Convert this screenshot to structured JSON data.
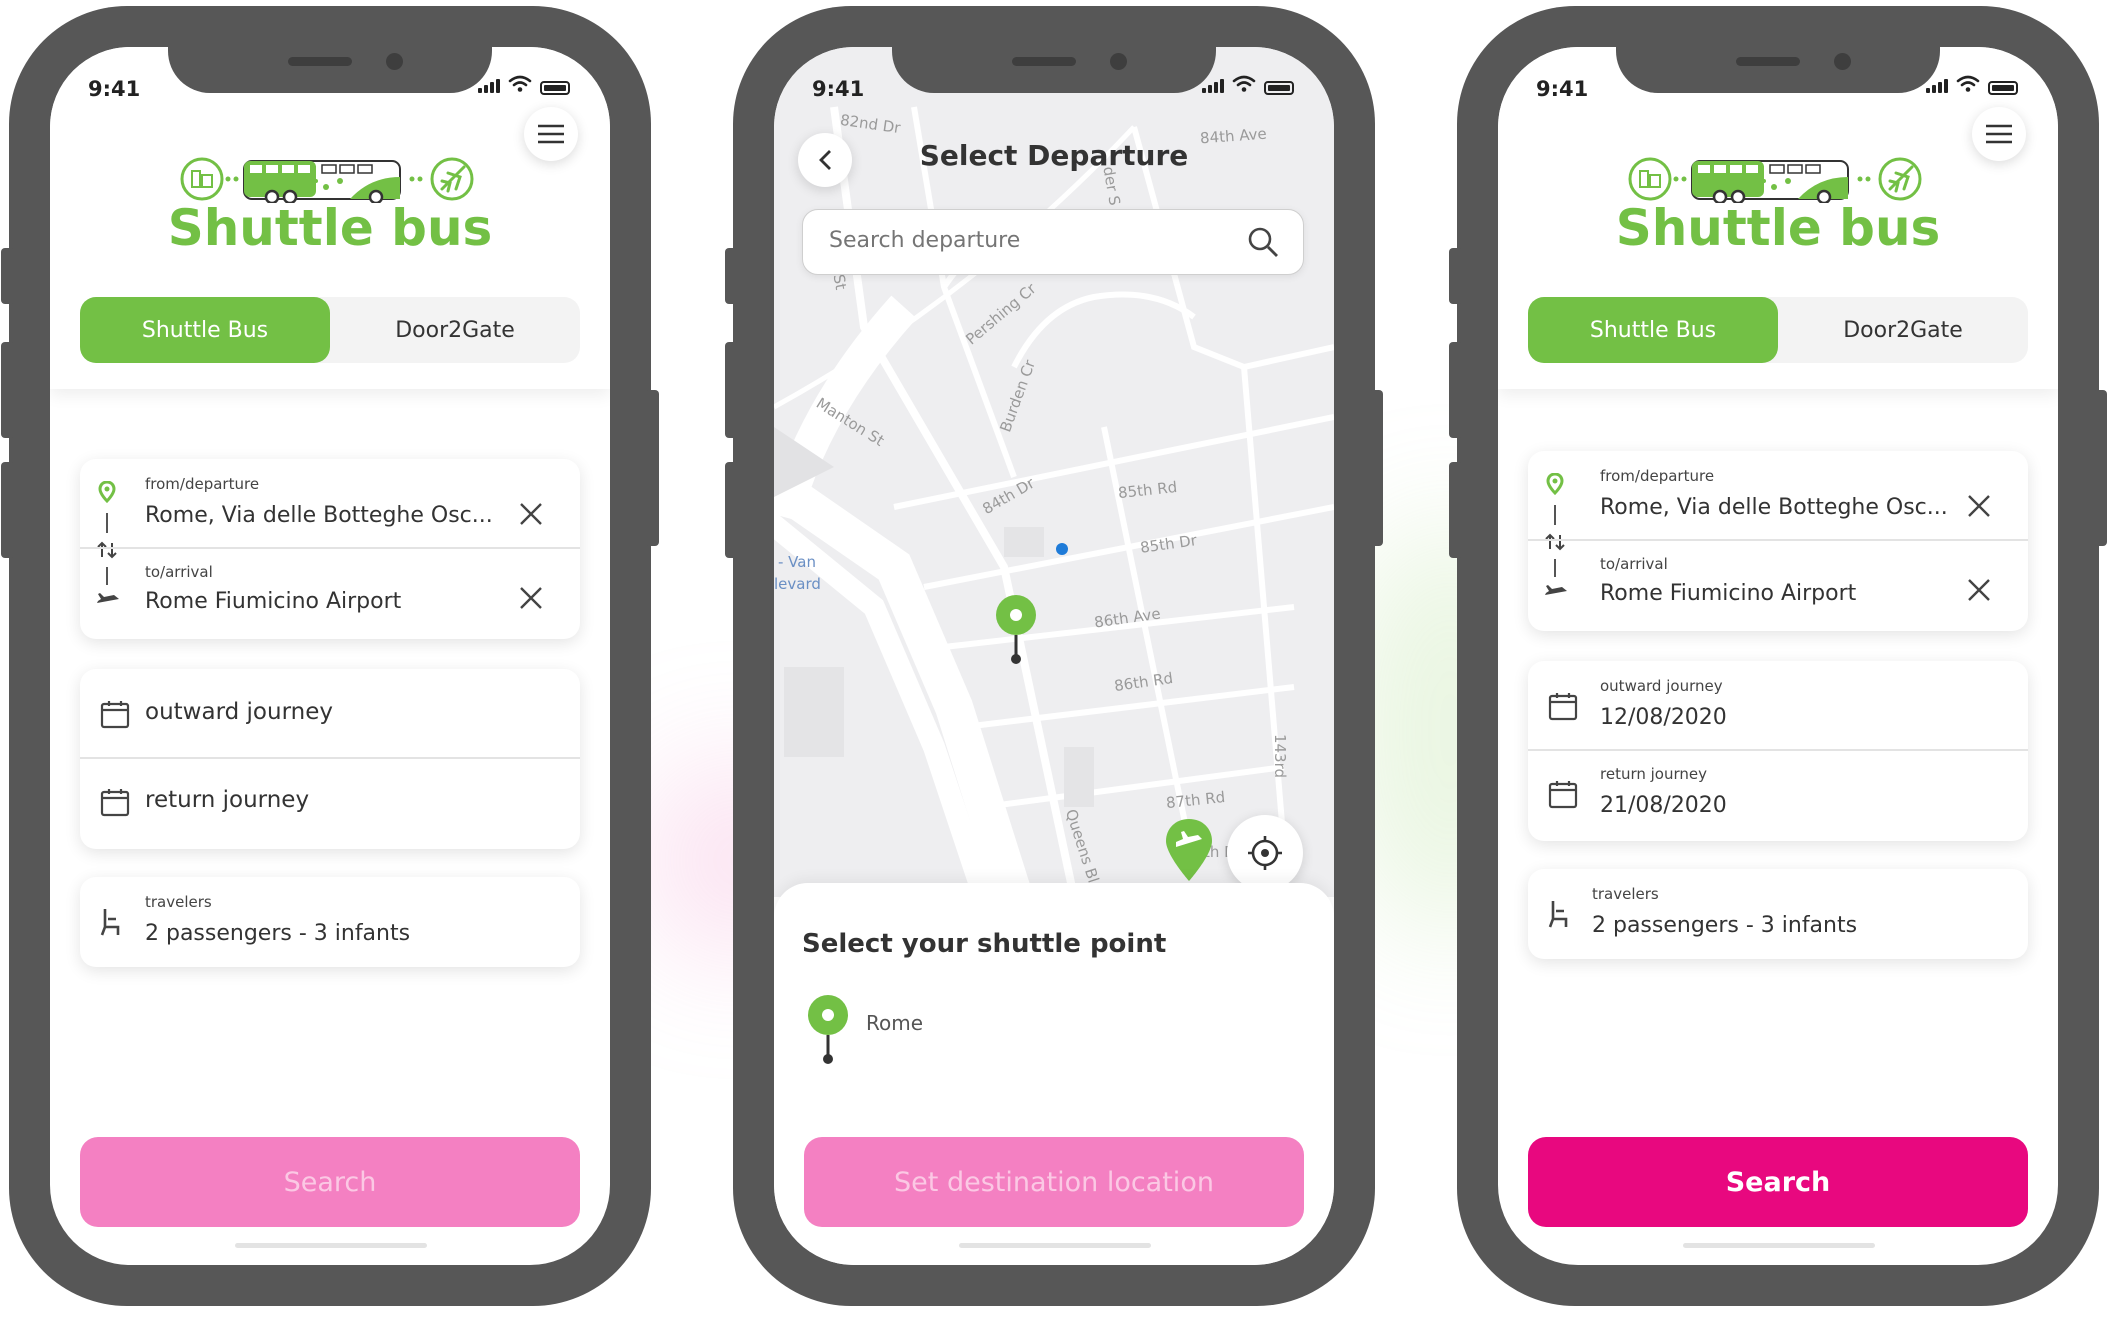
{
  "status_time": "9:41",
  "brand_title": "Shuttle bus",
  "colors": {
    "green": "#73c045",
    "pink_disabled": "#f480c2",
    "pink_active": "#e8087f",
    "frame": "#575757"
  },
  "screen1": {
    "tabs": [
      {
        "label": "Shuttle Bus",
        "active": true
      },
      {
        "label": "Door2Gate",
        "active": false
      }
    ],
    "from_label": "from/departure",
    "from_value": "Rome, Via delle Botteghe Osc...",
    "to_label": "to/arrival",
    "to_value": "Rome Fiumicino Airport",
    "outward_placeholder": "outward journey",
    "return_placeholder": "return journey",
    "travelers_label": "travelers",
    "travelers_value": "2 passengers - 3 infants",
    "search_label": "Search",
    "search_enabled": false
  },
  "screen2": {
    "title": "Select Departure",
    "search_placeholder": "Search departure",
    "map_labels": [
      "82nd Dr",
      "84th Ave",
      "Pershing Cr",
      "Burden Cr",
      "Manton St",
      "84th Dr",
      "85th Rd",
      "85th Dr",
      "86th Ave",
      "86th Rd",
      "87th Rd",
      "Queens Bl",
      "143rd",
      "- Van",
      "levard",
      "th Dr",
      "der S",
      "St"
    ],
    "sheet_title": "Select your shuttle point",
    "point_label": "Rome",
    "action_label": "Set destination location",
    "action_enabled": false
  },
  "screen3": {
    "tabs": [
      {
        "label": "Shuttle Bus",
        "active": true
      },
      {
        "label": "Door2Gate",
        "active": false
      }
    ],
    "from_label": "from/departure",
    "from_value": "Rome, Via delle Botteghe Osc...",
    "to_label": "to/arrival",
    "to_value": "Rome Fiumicino Airport",
    "outward_label": "outward journey",
    "outward_value": "12/08/2020",
    "return_label": "return journey",
    "return_value": "21/08/2020",
    "travelers_label": "travelers",
    "travelers_value": "2 passengers - 3 infants",
    "search_label": "Search",
    "search_enabled": true
  }
}
